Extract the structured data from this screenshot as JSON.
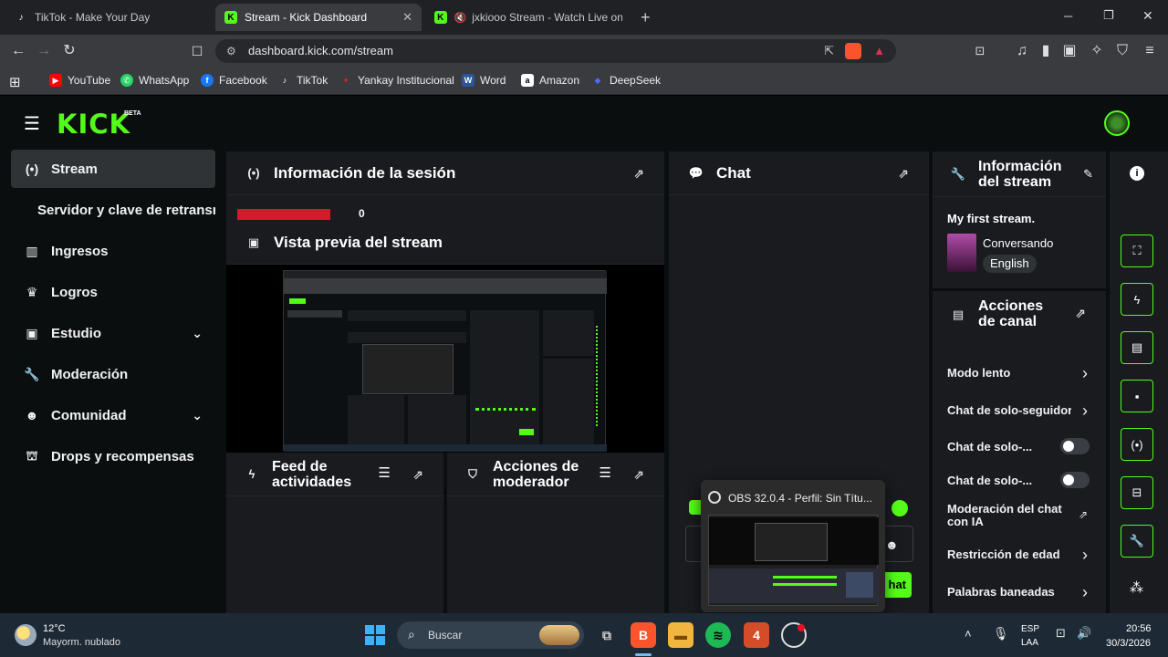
{
  "browser": {
    "tabs": [
      {
        "title": "TikTok - Make Your Day",
        "active": false
      },
      {
        "title": "Stream - Kick Dashboard",
        "active": true
      },
      {
        "title": "jxkiooo Stream - Watch Live on K",
        "active": false
      }
    ],
    "new_tab": "+",
    "url": "dashboard.kick.com/stream",
    "bookmarks": [
      "YouTube",
      "WhatsApp",
      "Facebook",
      "TikTok",
      "Yankay Institucional",
      "Word",
      "Amazon",
      "DeepSeek"
    ]
  },
  "kick": {
    "logo": "KICK",
    "logo_badge": "BETA",
    "brand_color": "#53fc18",
    "sidebar": [
      {
        "label": "Stream",
        "icon": "broadcast-icon",
        "active": true
      },
      {
        "label": "Servidor y clave de retransn",
        "icon": "",
        "active": false
      },
      {
        "label": "Ingresos",
        "icon": "chart-icon",
        "active": false
      },
      {
        "label": "Logros",
        "icon": "trophy-icon",
        "active": false
      },
      {
        "label": "Estudio",
        "icon": "studio-icon",
        "active": false,
        "expandable": true
      },
      {
        "label": "Moderación",
        "icon": "wrench-icon",
        "active": false
      },
      {
        "label": "Comunidad",
        "icon": "community-icon",
        "active": false,
        "expandable": true
      },
      {
        "label": "Drops y recompensas",
        "icon": "drops-icon",
        "active": false
      }
    ],
    "session_panel": {
      "title": "Información de la sesión",
      "status_badge": "",
      "count": "0"
    },
    "preview_panel": {
      "title": "Vista previa del stream"
    },
    "chat_panel": {
      "title": "Chat",
      "send_label": "hat"
    },
    "feed_panel": {
      "title_line1": "Feed de",
      "title_line2": "actividades"
    },
    "mod_panel": {
      "title_line1": "Acciones de",
      "title_line2": "moderador"
    },
    "stream_info": {
      "title_line1": "Información",
      "title_line2": "del stream",
      "stream_title": "My first stream.",
      "category": "Conversando",
      "language": "English"
    },
    "channel_actions": {
      "title_line1": "Acciones",
      "title_line2": "de canal",
      "rows": [
        {
          "label": "Modo lento",
          "control": "chevron"
        },
        {
          "label": "Chat de solo-seguidor",
          "control": "chevron"
        },
        {
          "label": "Chat de solo-...",
          "control": "toggle"
        },
        {
          "label": "Chat de solo-...",
          "control": "toggle"
        },
        {
          "label_line1": "Moderación del chat",
          "label_line2": "con IA",
          "control": "external"
        },
        {
          "label": "Restricción de edad",
          "control": "chevron"
        },
        {
          "label": "Palabras baneadas",
          "control": "chevron"
        }
      ]
    }
  },
  "obs_popup": {
    "title": "OBS 32.0.4 - Perfil: Sin Títu..."
  },
  "taskbar": {
    "weather_temp": "12°C",
    "weather_desc": "Mayorm. nublado",
    "search_placeholder": "Buscar",
    "lang_line1": "ESP",
    "lang_line2": "LAA",
    "time": "20:56",
    "date": "30/3/2026"
  }
}
